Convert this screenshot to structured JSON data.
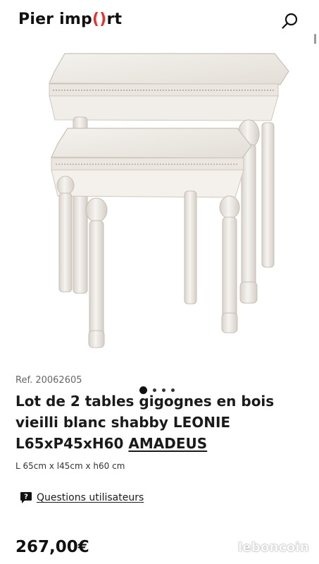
{
  "header": {
    "logo_left": "Pier imp",
    "logo_accent": "()",
    "logo_right": "rt",
    "search_icon": "search-icon"
  },
  "gallery": {
    "current_index": 1,
    "dot_count": 4
  },
  "product": {
    "ref": "Ref. 20062605",
    "title_main": "Lot de 2 tables gigognes en bois vieilli blanc shabby LEONIE L65xP45xH60",
    "brand": "AMADEUS",
    "dimensions": "L 65cm x l45cm x h60 cm",
    "price": "267,00€"
  },
  "questions": {
    "icon": "question-bubble-icon",
    "label": "Questions utilisateurs"
  },
  "watermark": {
    "text": "leboncoin"
  },
  "colors": {
    "accent": "#e5322d",
    "text": "#1a1a1a",
    "muted": "#666666"
  }
}
